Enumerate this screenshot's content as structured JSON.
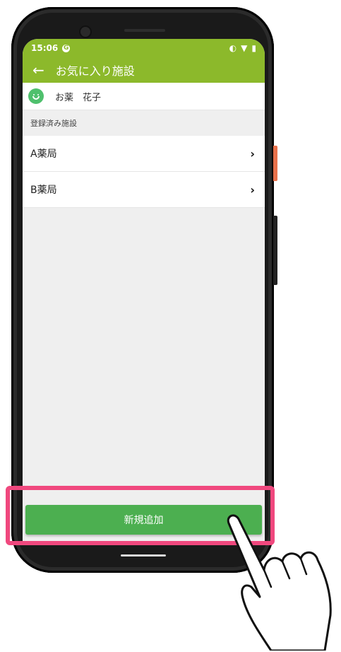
{
  "status_bar": {
    "time": "15:06",
    "status_icons": [
      "g-icon",
      "sync-icon",
      "wifi-icon",
      "battery-icon"
    ]
  },
  "app_bar": {
    "back_icon": "arrow-left-icon",
    "title": "お気に入り施設"
  },
  "user": {
    "avatar_icon": "smiley-face-icon",
    "name": "お薬　花子"
  },
  "section": {
    "header": "登録済み施設"
  },
  "facilities": [
    {
      "name": "A薬局"
    },
    {
      "name": "B薬局"
    }
  ],
  "chevron": "›",
  "bottom": {
    "add_button_label": "新規追加"
  },
  "colors": {
    "accent": "#8cb92b",
    "button": "#4caf50",
    "highlight": "#f0487e"
  }
}
